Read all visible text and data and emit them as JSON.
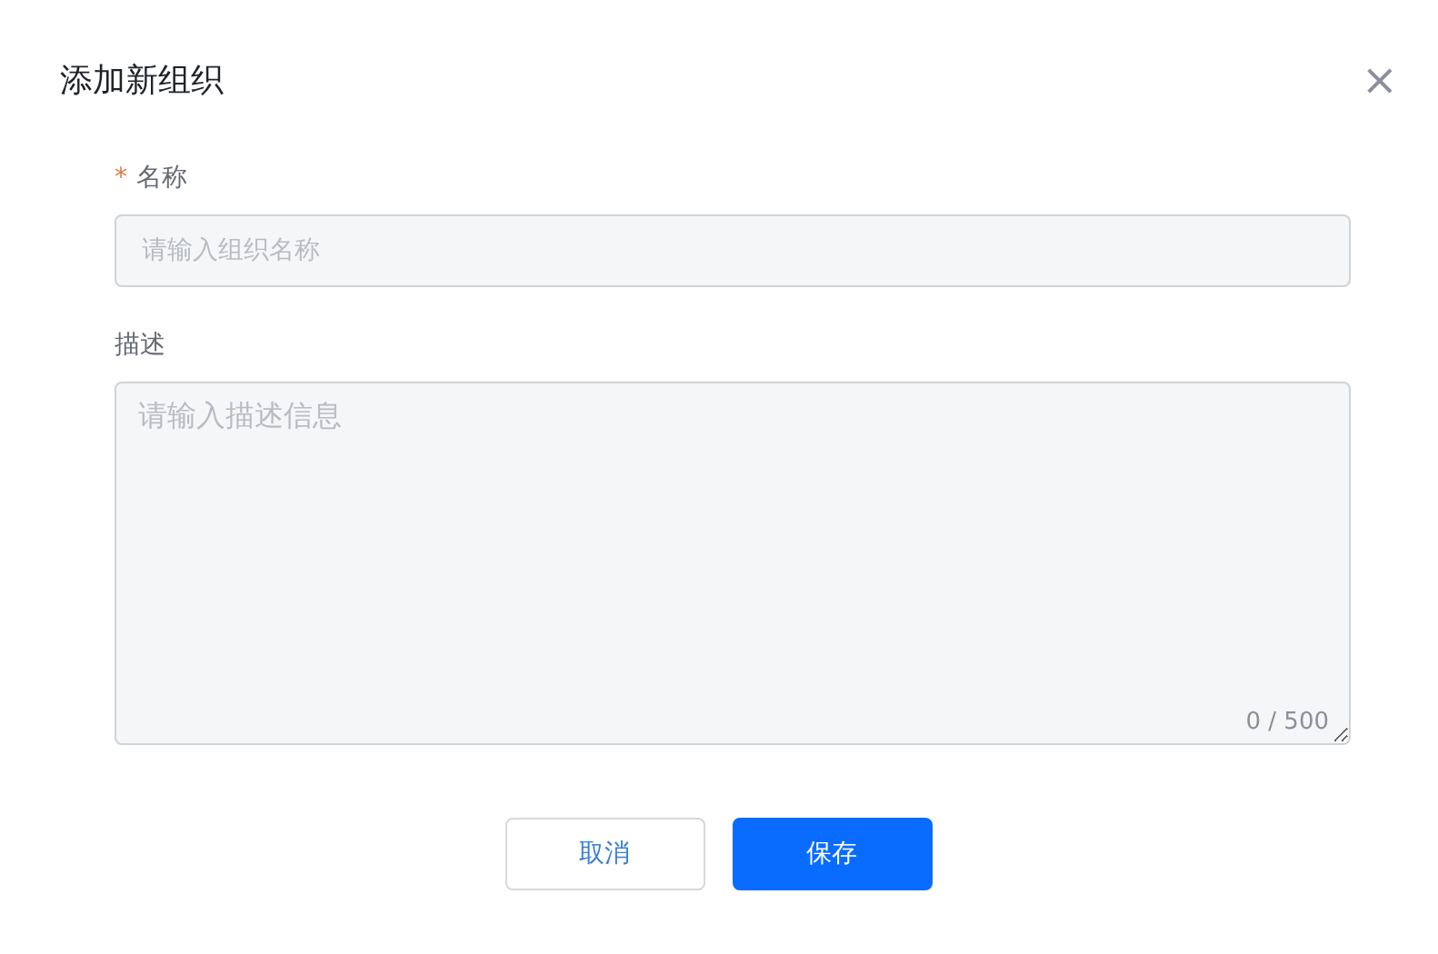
{
  "dialog": {
    "title": "添加新组织",
    "close": "×"
  },
  "fields": [
    {
      "kind": "input",
      "label": "名称",
      "required_mark": "*",
      "placeholder": "请输入组织名称"
    },
    {
      "kind": "textarea",
      "label": "描述",
      "placeholder": "请输入描述信息",
      "counter": "0 / 500"
    }
  ],
  "buttons": [
    {
      "label": "取消",
      "primary": false
    },
    {
      "label": "保存",
      "primary": true
    }
  ]
}
